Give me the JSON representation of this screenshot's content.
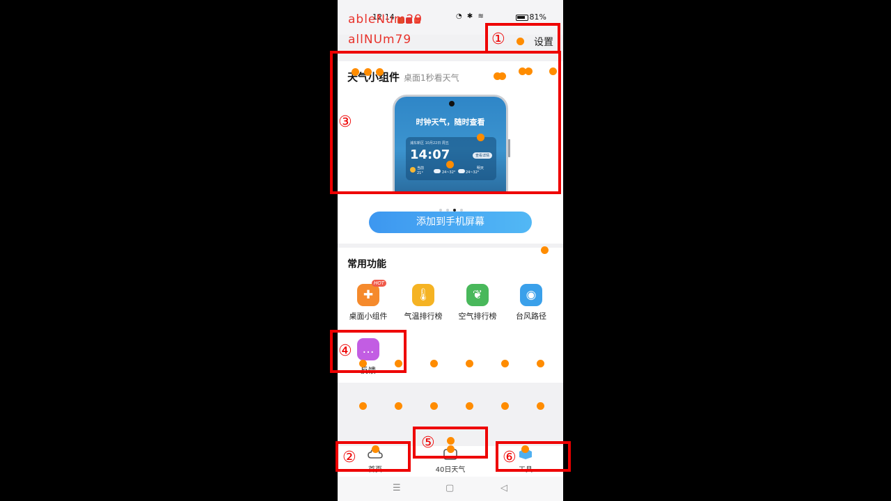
{
  "status_bar": {
    "time": "12:14",
    "battery": "81%"
  },
  "header": {
    "settings_label": "设置"
  },
  "widget_card": {
    "title": "天气小组件",
    "subtitle": "桌面1秒看天气",
    "preview": {
      "heading": "时钟天气，随时查看",
      "location": "浦东新区  10月22日 周五",
      "time": "14:07",
      "badge": "查看详情",
      "today_label": "当前",
      "today_temp": "21°",
      "today_range": "24~32°",
      "tomorrow_label": "明天",
      "tomorrow_range": "24~32°"
    },
    "page_dots": {
      "count": 4,
      "active_index": 2
    },
    "add_button": "添加到手机屏幕"
  },
  "functions": {
    "title": "常用功能",
    "items": [
      {
        "label": "桌面小组件",
        "icon": "puzzle-icon",
        "color": "#f58a2c",
        "badge": "HOT"
      },
      {
        "label": "气温排行榜",
        "icon": "thermometer-icon",
        "color": "#f5b323"
      },
      {
        "label": "空气排行榜",
        "icon": "leaf-icon",
        "color": "#49b85b"
      },
      {
        "label": "台风路径",
        "icon": "typhoon-icon",
        "color": "#3aa0ea"
      },
      {
        "label": "反馈",
        "icon": "chat-icon",
        "color": "#c25de3"
      }
    ]
  },
  "bottom_nav": {
    "items": [
      {
        "label": "首页",
        "icon": "cloud-icon"
      },
      {
        "label": "40日天气",
        "icon": "calendar-icon"
      },
      {
        "label": "工具",
        "icon": "tools-icon"
      }
    ]
  },
  "overlay": {
    "labels": [
      "ableNum29",
      "allNUm79"
    ],
    "box_numbers": [
      "①",
      "②",
      "③",
      "④",
      "⑤",
      "⑥"
    ],
    "box_color": "#e00000",
    "dot_color": "#ff8c00"
  }
}
